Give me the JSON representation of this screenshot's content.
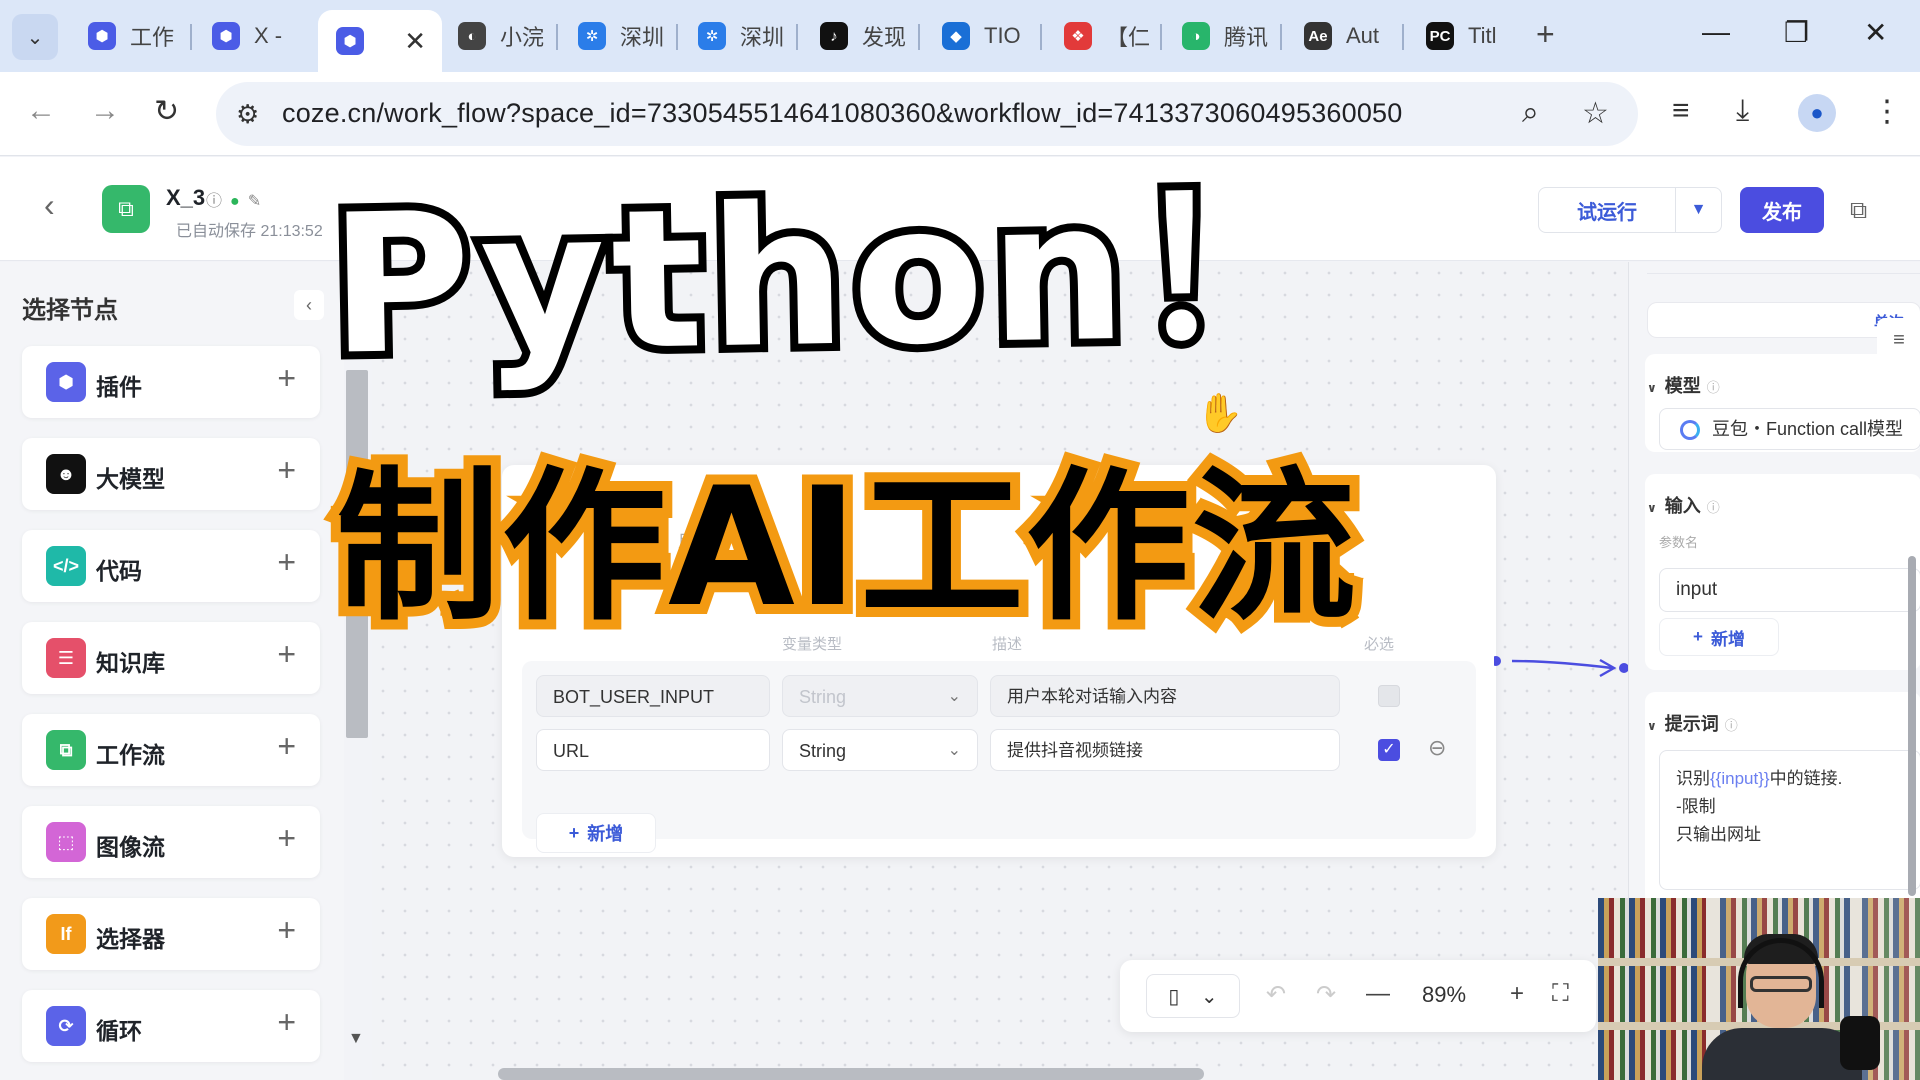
{
  "browser": {
    "tabs": [
      {
        "label": "工作",
        "color": "#4b5ce6",
        "glyph": "⬢"
      },
      {
        "label": "X -",
        "color": "#4b5ce6",
        "glyph": "⬢"
      },
      {
        "label": "",
        "color": "#4b5ce6",
        "glyph": "⬢",
        "active": true,
        "close": "✕"
      },
      {
        "label": "小浣",
        "color": "#444",
        "glyph": "◐"
      },
      {
        "label": "深圳",
        "color": "#2b7de9",
        "glyph": "✲"
      },
      {
        "label": "深圳",
        "color": "#2b7de9",
        "glyph": "✲"
      },
      {
        "label": "发现",
        "color": "#111",
        "glyph": "♪"
      },
      {
        "label": "TIO",
        "color": "#1a6fd6",
        "glyph": "◆"
      },
      {
        "label": "【仁",
        "color": "#e23a3a",
        "glyph": "❖"
      },
      {
        "label": "腾讯",
        "color": "#28b56b",
        "glyph": "◑"
      },
      {
        "label": "Aut",
        "color": "#333",
        "glyph": "Ae"
      },
      {
        "label": "Titl",
        "color": "#111",
        "glyph": "PC"
      }
    ],
    "new_tab": "+",
    "url": "coze.cn/work_flow?space_id=7330545514641080360&workflow_id=7413373060495360050"
  },
  "header": {
    "workflow_name": "X_3",
    "autosave": "已自动保存 21:13:52",
    "trial_run": "试运行",
    "publish": "发布"
  },
  "left_panel": {
    "title": "选择节点",
    "nodes": [
      {
        "label": "插件",
        "color": "#5b63e8",
        "glyph": "⬢"
      },
      {
        "label": "大模型",
        "color": "#111111",
        "glyph": "☻"
      },
      {
        "label": "代码",
        "color": "#1fb9a8",
        "glyph": "</>"
      },
      {
        "label": "知识库",
        "color": "#e5506a",
        "glyph": "☰"
      },
      {
        "label": "工作流",
        "color": "#35b86b",
        "glyph": "⧉"
      },
      {
        "label": "图像流",
        "color": "#d366d6",
        "glyph": "⬚"
      },
      {
        "label": "选择器",
        "color": "#f29a1a",
        "glyph": "If"
      },
      {
        "label": "循环",
        "color": "#5b63e8",
        "glyph": "⟳"
      }
    ]
  },
  "start_node": {
    "partial_text_1": "用于",
    "partial_text_2": "作流",
    "faded_col_type": "变量类型",
    "faded_col_desc": "描述",
    "faded_col_required": "必选",
    "params": [
      {
        "name": "BOT_USER_INPUT",
        "type": "String",
        "desc": "用户本轮对话输入内容",
        "required": false,
        "disabled": true
      },
      {
        "name": "URL",
        "type": "String",
        "desc": "提供抖音视频链接",
        "required": true,
        "disabled": false
      }
    ],
    "add_label": "新增"
  },
  "canvas_toolbar": {
    "zoom": "89%"
  },
  "right_panel": {
    "segment_label": "单次",
    "model_title": "模型",
    "model_value": "豆包・Function call模型",
    "input_title": "输入",
    "param_label": "参数名",
    "input_value": "input",
    "add_label": "新增",
    "prompt_title": "提示词",
    "prompt_line1_pre": "识别",
    "prompt_line1_var": "{{input}}",
    "prompt_line1_post": "中的链接.",
    "prompt_line2": "-限制",
    "prompt_line3": "只输出网址"
  },
  "overlay": {
    "title_en": "Python！",
    "title_cn": "制作AI工作流"
  }
}
